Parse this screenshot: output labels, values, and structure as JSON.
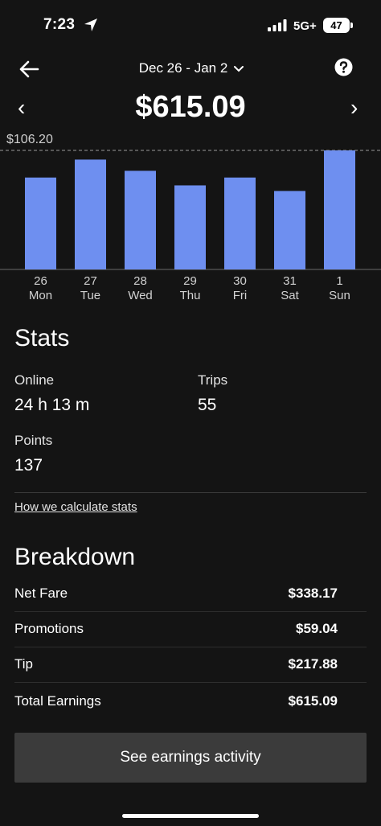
{
  "status_bar": {
    "time": "7:23",
    "network": "5G+",
    "battery": "47"
  },
  "header": {
    "date_range": "Dec 26 - Jan 2",
    "prev_symbol": "‹",
    "next_symbol": "›"
  },
  "total_earnings": "$615.09",
  "chart_data": {
    "type": "bar",
    "categories": [
      "26 Mon",
      "27 Tue",
      "28 Wed",
      "29 Thu",
      "30 Fri",
      "31 Sat",
      "1 Sun"
    ],
    "day_numbers": [
      "26",
      "27",
      "28",
      "29",
      "30",
      "31",
      "1"
    ],
    "day_names": [
      "Mon",
      "Tue",
      "Wed",
      "Thu",
      "Fri",
      "Sat",
      "Sun"
    ],
    "values": [
      82,
      98,
      88,
      75,
      82,
      70,
      106.2
    ],
    "max_label": "$106.20",
    "ylim": [
      0,
      106.2
    ],
    "bar_color": "#6e8ff0"
  },
  "stats": {
    "title": "Stats",
    "online_label": "Online",
    "online_value": "24 h 13 m",
    "trips_label": "Trips",
    "trips_value": "55",
    "points_label": "Points",
    "points_value": "137",
    "calc_link": "How we calculate stats"
  },
  "breakdown": {
    "title": "Breakdown",
    "rows": [
      {
        "label": "Net Fare",
        "amount": "$338.17"
      },
      {
        "label": "Promotions",
        "amount": "$59.04"
      },
      {
        "label": "Tip",
        "amount": "$217.88"
      },
      {
        "label": "Total Earnings",
        "amount": "$615.09"
      }
    ]
  },
  "cta_label": "See earnings activity",
  "colors": {
    "background": "#141414",
    "bar": "#6e8ff0",
    "button": "#3b3b3b"
  }
}
